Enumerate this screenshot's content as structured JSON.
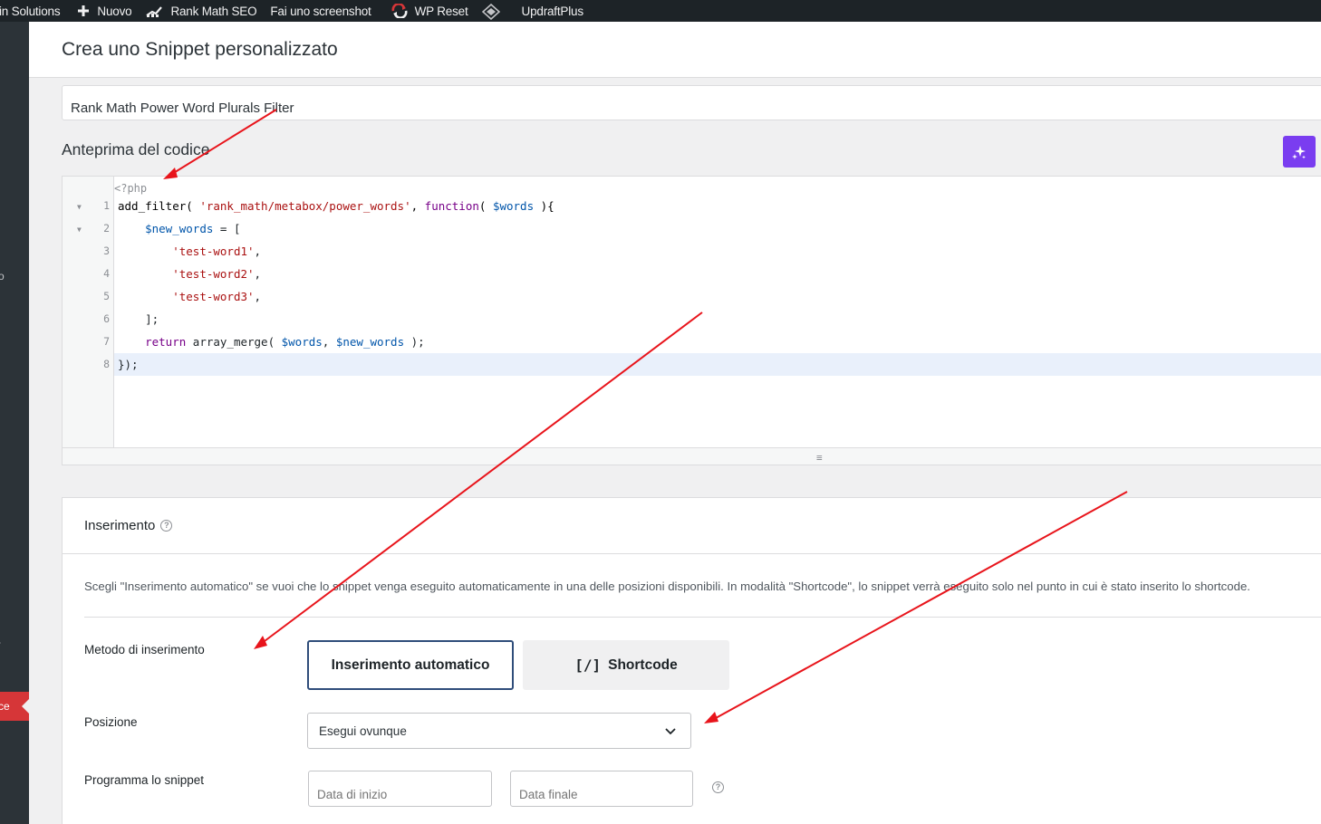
{
  "admin_bar": {
    "items": [
      {
        "label": "in Solutions",
        "icon": ""
      },
      {
        "label": "Nuovo",
        "icon": "plus-icon"
      },
      {
        "label": "Rank Math SEO",
        "icon": "rank-math-icon"
      },
      {
        "label": "Fai uno screenshot",
        "icon": ""
      },
      {
        "label": "WP Reset",
        "icon": "wp-reset-icon"
      },
      {
        "label": "",
        "icon": "diamond-icon"
      },
      {
        "label": "UpdraftPlus",
        "icon": ""
      }
    ]
  },
  "side_menu": {
    "glyph_a": "o",
    "glyph_b": "-",
    "active_label": "ce"
  },
  "page": {
    "title": "Crea uno Snippet personalizzato"
  },
  "snippet": {
    "title_value": "Rank Math Power Word Plurals Filter"
  },
  "code_preview": {
    "label": "Anteprima del codice",
    "php_open": "<?php",
    "lines": [
      {
        "num": "1",
        "text": "add_filter( 'rank_math/metabox/power_words', function( $words ){",
        "fold": true
      },
      {
        "num": "2",
        "text": "    $new_words = [",
        "fold": true
      },
      {
        "num": "3",
        "text": "        'test-word1',",
        "fold": false
      },
      {
        "num": "4",
        "text": "        'test-word2',",
        "fold": false
      },
      {
        "num": "5",
        "text": "        'test-word3',",
        "fold": false
      },
      {
        "num": "6",
        "text": "    ];",
        "fold": false
      },
      {
        "num": "7",
        "text": "    return array_merge( $words, $new_words );",
        "fold": false
      },
      {
        "num": "8",
        "text": "});",
        "fold": false
      }
    ],
    "active_line": 8,
    "resize_handle": "≡"
  },
  "insertion": {
    "title": "Inserimento",
    "description": "Scegli \"Inserimento automatico\" se vuoi che lo snippet venga eseguito automaticamente in una delle posizioni disponibili. In modalità \"Shortcode\", lo snippet verrà eseguito solo nel punto in cui è stato inserito lo shortcode.",
    "method_label": "Metodo di inserimento",
    "method_auto": "Inserimento automatico",
    "method_shortcode": "Shortcode",
    "shortcode_glyph": "[/]",
    "position_label": "Posizione",
    "position_value": "Esegui ovunque",
    "schedule_label": "Programma lo snippet",
    "start_placeholder": "Data di inizio",
    "end_placeholder": "Data finale",
    "help_glyph": "?"
  },
  "colors": {
    "accent_purple": "#7a3df0",
    "arrow_red": "#e8141b",
    "active_menu": "#d63638",
    "selected_border": "#2f4d7a"
  }
}
